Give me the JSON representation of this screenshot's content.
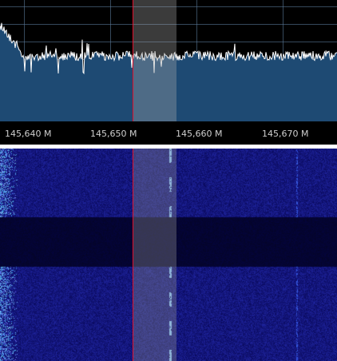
{
  "spectrum": {
    "freq_labels": [
      "145,640 M",
      "145,650 M",
      "145,660 M",
      "145,670 M"
    ],
    "colors": {
      "background": "#000000",
      "fill": "#1e4a73",
      "trace": "#ffffff",
      "grid": "#5a7a9a",
      "cursor": "#e0102a",
      "filter_band": "#a0a0a0"
    }
  },
  "waterfall": {
    "colors": {
      "base": "#0a0a6e",
      "signal": "#8fc8ff"
    }
  }
}
